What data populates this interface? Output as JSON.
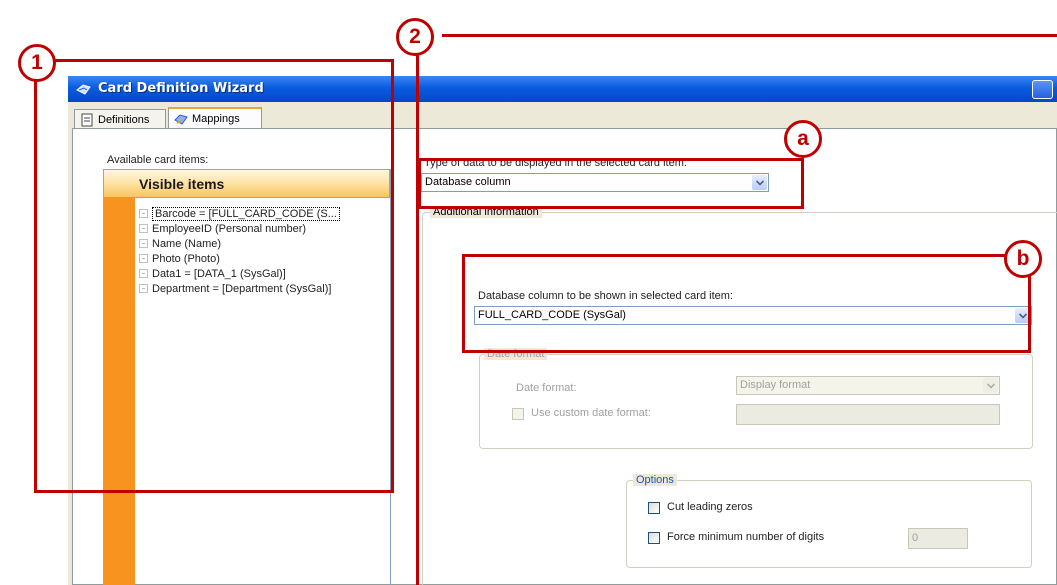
{
  "window": {
    "title": "Card Definition Wizard",
    "tabs": [
      {
        "label": "Definitions",
        "icon": "document-icon",
        "active": false
      },
      {
        "label": "Mappings",
        "icon": "mapping-icon",
        "active": true
      }
    ]
  },
  "left_panel": {
    "available_label": "Available card items:",
    "group_header": "Visible items",
    "items": [
      {
        "label": "Barcode = [FULL_CARD_CODE (S...",
        "selected": true
      },
      {
        "label": "EmployeeID  (Personal number)",
        "selected": false
      },
      {
        "label": "Name (Name)",
        "selected": false
      },
      {
        "label": "Photo (Photo)",
        "selected": false
      },
      {
        "label": "Data1 = [DATA_1 (SysGal)]",
        "selected": false
      },
      {
        "label": "Department = [Department (SysGal)]",
        "selected": false
      }
    ]
  },
  "right_panel": {
    "data_type_label": "Type of data to be displayed in the selected card item:",
    "data_type_value": "Database column",
    "additional_info_legend": "Additional information",
    "db_column_label": "Database column to be shown in selected card item:",
    "db_column_value": "FULL_CARD_CODE (SysGal)",
    "date_format_legend": "Date format",
    "date_format_label": "Date format:",
    "date_format_value": "Display format",
    "custom_date_label": "Use custom date format:",
    "custom_date_value": "",
    "options_legend": "Options",
    "cut_zeros_label": "Cut leading zeros",
    "force_digits_label": "Force minimum number of digits",
    "min_digits_value": "0"
  },
  "annotations": {
    "callout_1": "1",
    "callout_2": "2",
    "callout_a": "a",
    "callout_b": "b",
    "color": "#c00000"
  },
  "colors": {
    "titlebar": "#0a5ce0",
    "orange_bar": "#f7931e",
    "window_bg": "#ece9d8"
  }
}
